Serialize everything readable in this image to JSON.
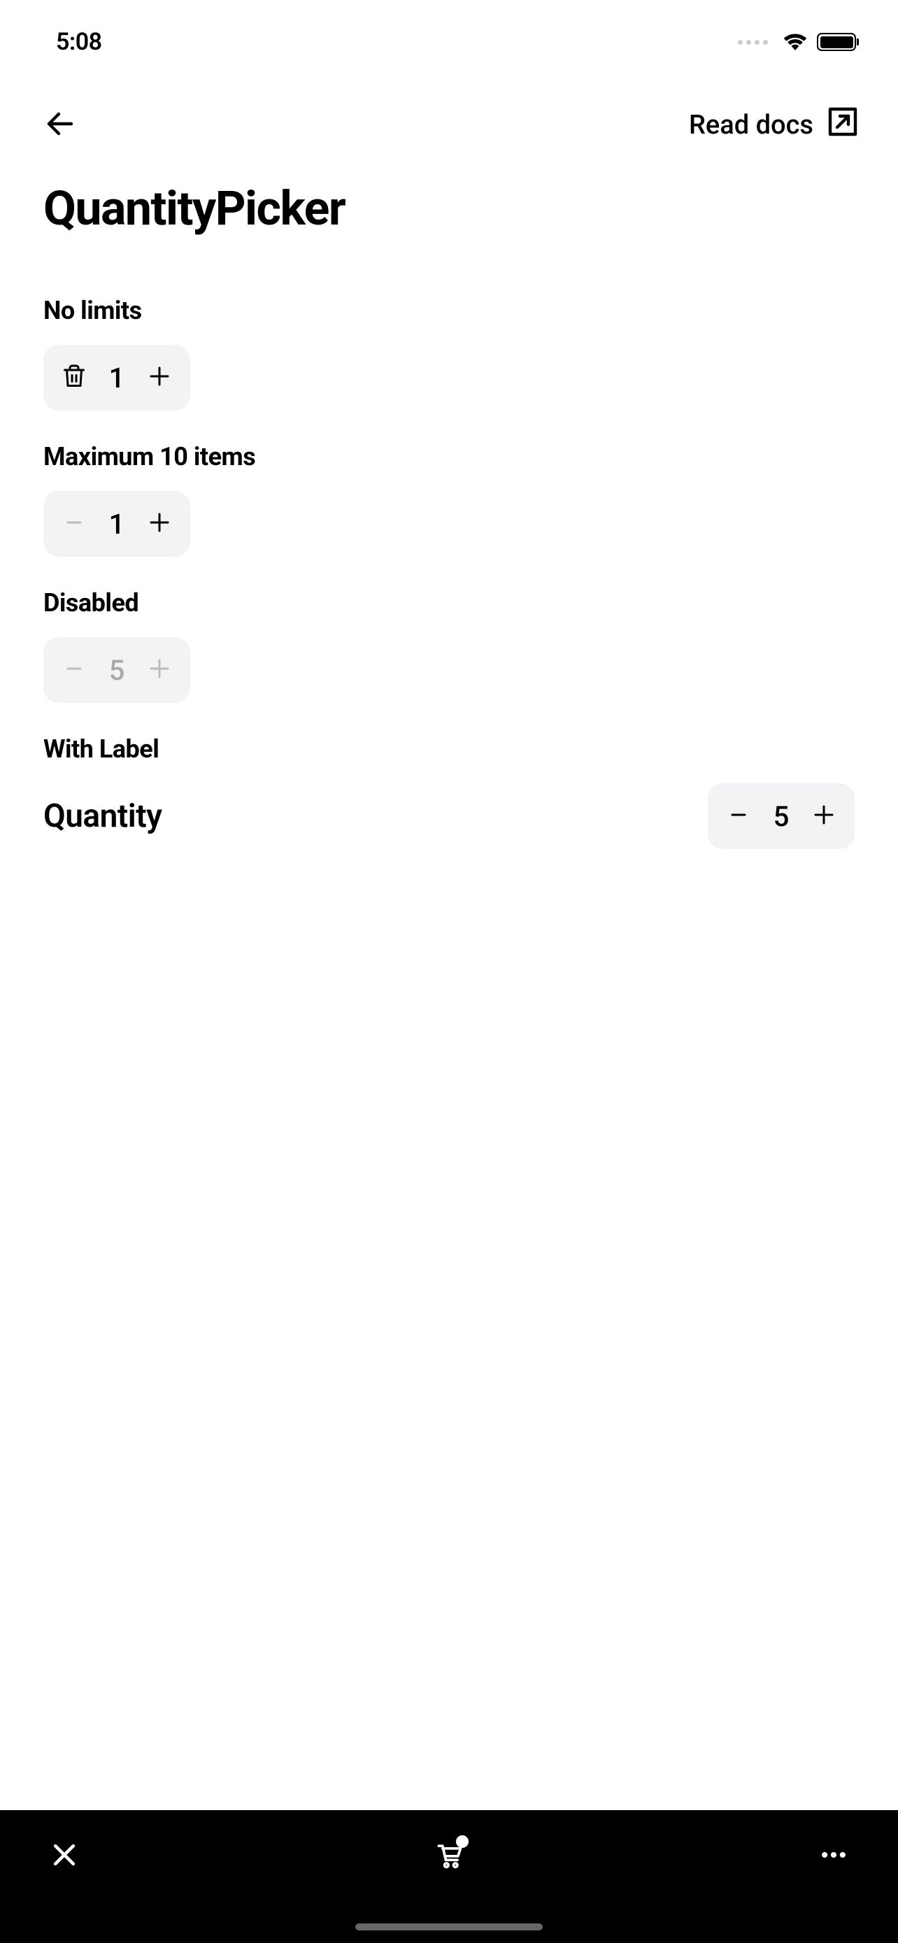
{
  "status": {
    "time": "5:08"
  },
  "nav": {
    "docs_label": "Read docs"
  },
  "page_title": "QuantityPicker",
  "sections": {
    "no_limits": {
      "title": "No limits",
      "value": "1"
    },
    "max_ten": {
      "title": "Maximum 10 items",
      "value": "1"
    },
    "disabled": {
      "title": "Disabled",
      "value": "5"
    },
    "with_label": {
      "title": "With Label",
      "label": "Quantity",
      "value": "5"
    }
  }
}
